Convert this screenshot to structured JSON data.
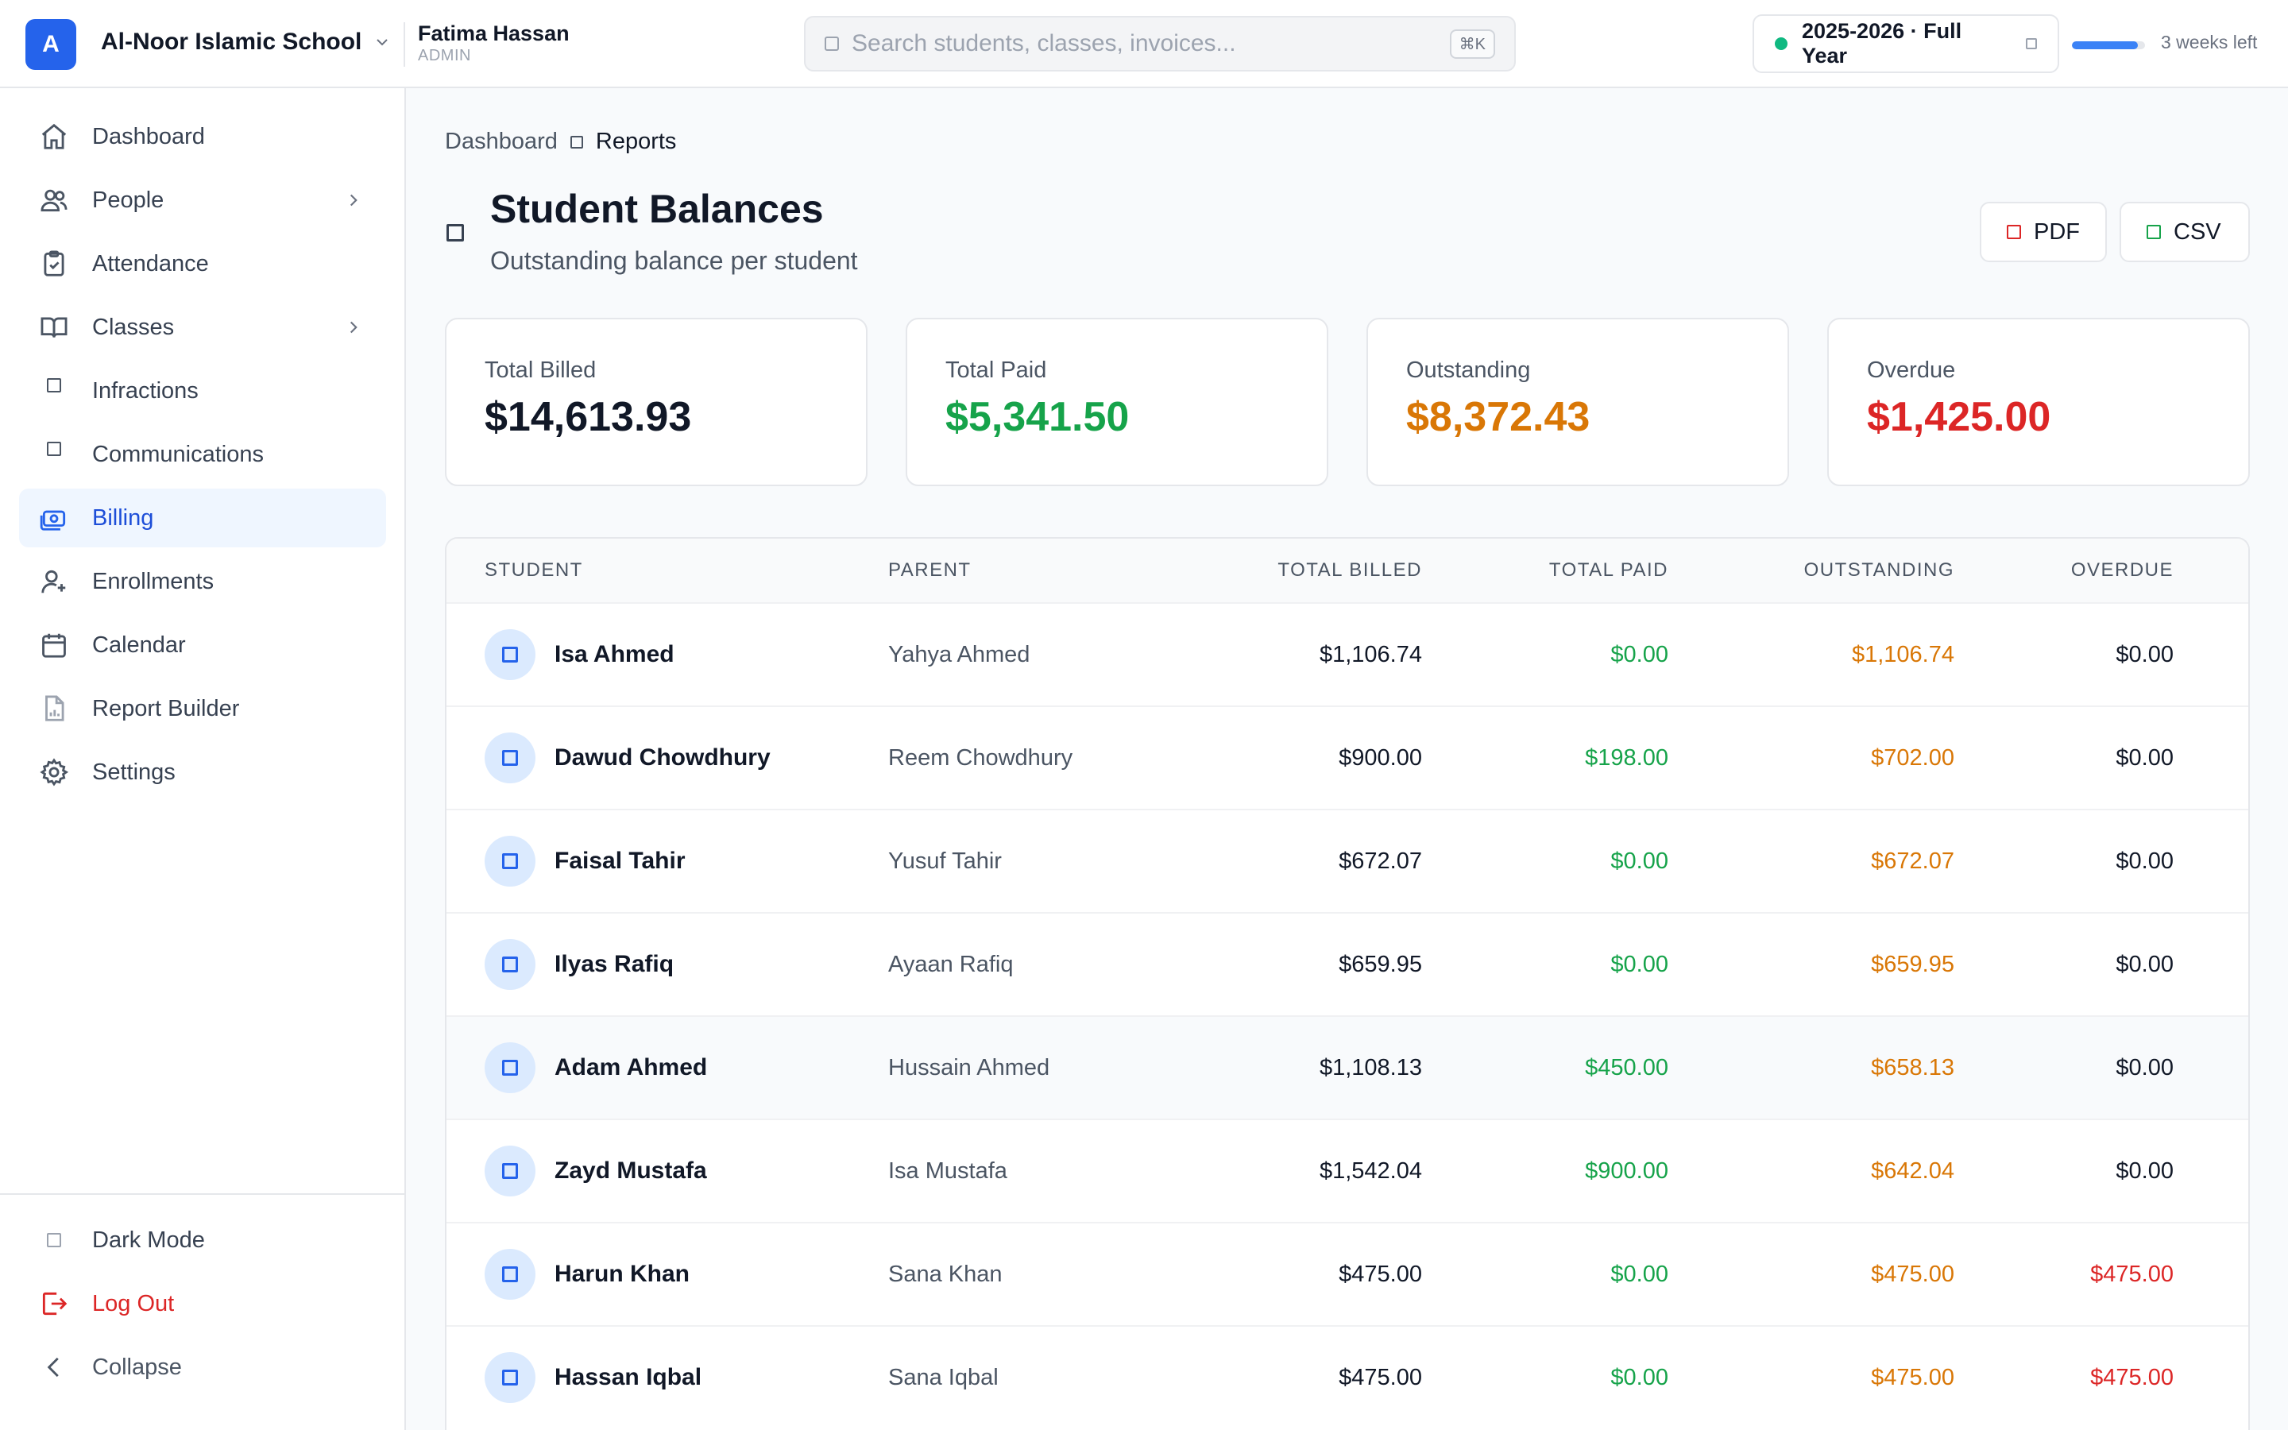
{
  "header": {
    "logo_letter": "A",
    "school_name": "Al-Noor Islamic School",
    "user_name": "Fatima Hassan",
    "user_role": "ADMIN",
    "search_placeholder": "Search students, classes, invoices...",
    "search_shortcut": "⌘K",
    "school_year": "2025-2026 · Full Year",
    "term_progress_percent": 90,
    "weeks_left": "3 weeks left"
  },
  "sidebar": {
    "items": [
      {
        "label": "Dashboard",
        "icon": "home-icon"
      },
      {
        "label": "People",
        "icon": "users-icon",
        "has_children": true
      },
      {
        "label": "Attendance",
        "icon": "clipboard-check-icon"
      },
      {
        "label": "Classes",
        "icon": "book-open-icon",
        "has_children": true
      },
      {
        "label": "Infractions",
        "icon": "square-icon"
      },
      {
        "label": "Communications",
        "icon": "square-icon"
      },
      {
        "label": "Billing",
        "icon": "banknote-icon",
        "active": true
      },
      {
        "label": "Enrollments",
        "icon": "user-plus-icon"
      },
      {
        "label": "Calendar",
        "icon": "calendar-icon"
      },
      {
        "label": "Report Builder",
        "icon": "file-chart-icon"
      },
      {
        "label": "Settings",
        "icon": "gear-icon"
      }
    ],
    "bottom": {
      "dark_mode": "Dark Mode",
      "logout": "Log Out",
      "collapse": "Collapse"
    }
  },
  "breadcrumb": {
    "parent": "Dashboard",
    "current": "Reports"
  },
  "page": {
    "title": "Student Balances",
    "subtitle": "Outstanding balance per student",
    "pdf_label": "PDF",
    "csv_label": "CSV"
  },
  "summary": {
    "total_billed_label": "Total Billed",
    "total_billed": "$14,613.93",
    "total_paid_label": "Total Paid",
    "total_paid": "$5,341.50",
    "outstanding_label": "Outstanding",
    "outstanding": "$8,372.43",
    "overdue_label": "Overdue",
    "overdue": "$1,425.00"
  },
  "colors": {
    "accent": "#2563eb",
    "paid": "#16a34a",
    "outstanding": "#d97706",
    "overdue": "#dc2626"
  },
  "table": {
    "columns": [
      "STUDENT",
      "PARENT",
      "TOTAL BILLED",
      "TOTAL PAID",
      "OUTSTANDING",
      "OVERDUE"
    ],
    "rows": [
      {
        "student": "Isa Ahmed",
        "parent": "Yahya Ahmed",
        "billed": "$1,106.74",
        "paid": "$0.00",
        "outstanding": "$1,106.74",
        "overdue": "$0.00"
      },
      {
        "student": "Dawud Chowdhury",
        "parent": "Reem Chowdhury",
        "billed": "$900.00",
        "paid": "$198.00",
        "outstanding": "$702.00",
        "overdue": "$0.00"
      },
      {
        "student": "Faisal Tahir",
        "parent": "Yusuf Tahir",
        "billed": "$672.07",
        "paid": "$0.00",
        "outstanding": "$672.07",
        "overdue": "$0.00"
      },
      {
        "student": "Ilyas Rafiq",
        "parent": "Ayaan Rafiq",
        "billed": "$659.95",
        "paid": "$0.00",
        "outstanding": "$659.95",
        "overdue": "$0.00"
      },
      {
        "student": "Adam Ahmed",
        "parent": "Hussain Ahmed",
        "billed": "$1,108.13",
        "paid": "$450.00",
        "outstanding": "$658.13",
        "overdue": "$0.00"
      },
      {
        "student": "Zayd Mustafa",
        "parent": "Isa Mustafa",
        "billed": "$1,542.04",
        "paid": "$900.00",
        "outstanding": "$642.04",
        "overdue": "$0.00"
      },
      {
        "student": "Harun Khan",
        "parent": "Sana Khan",
        "billed": "$475.00",
        "paid": "$0.00",
        "outstanding": "$475.00",
        "overdue": "$475.00"
      },
      {
        "student": "Hassan Iqbal",
        "parent": "Sana Iqbal",
        "billed": "$475.00",
        "paid": "$0.00",
        "outstanding": "$475.00",
        "overdue": "$475.00"
      }
    ]
  }
}
